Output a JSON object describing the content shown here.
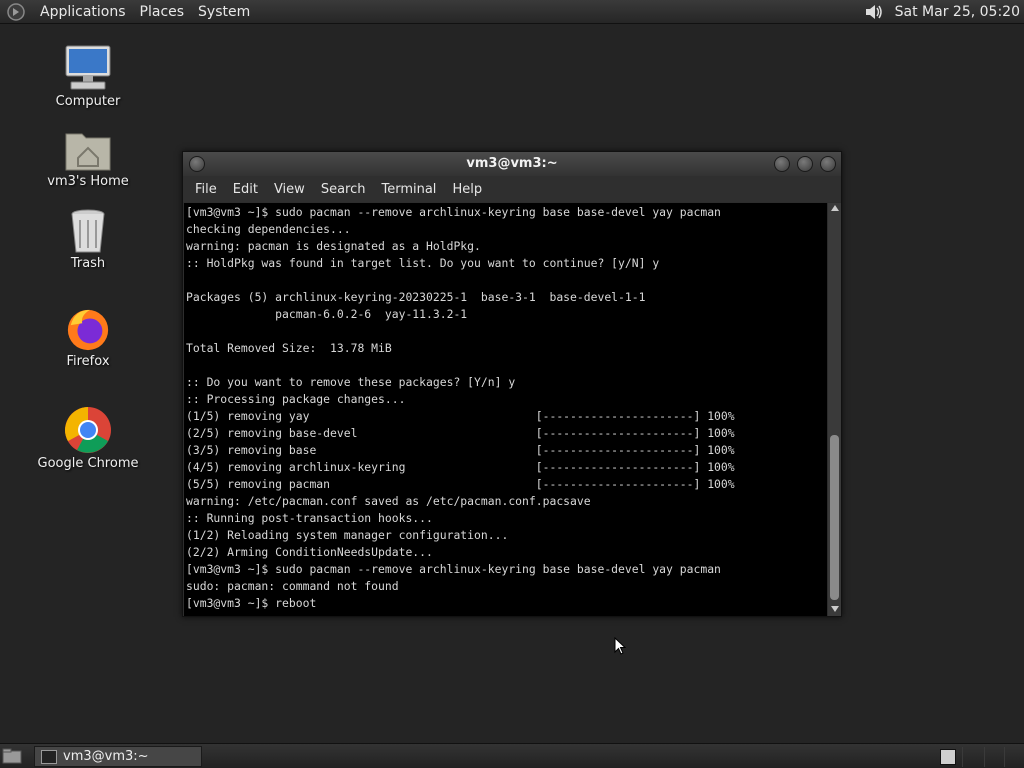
{
  "top_panel": {
    "menus": [
      "Applications",
      "Places",
      "System"
    ],
    "clock": "Sat Mar 25, 05:20"
  },
  "desktop_icons": [
    {
      "label": "Computer"
    },
    {
      "label": "vm3's Home"
    },
    {
      "label": "Trash"
    },
    {
      "label": "Firefox"
    },
    {
      "label": "Google Chrome"
    }
  ],
  "terminal": {
    "title": "vm3@vm3:~",
    "menu": [
      "File",
      "Edit",
      "View",
      "Search",
      "Terminal",
      "Help"
    ],
    "lines": [
      "[vm3@vm3 ~]$ sudo pacman --remove archlinux-keyring base base-devel yay pacman",
      "checking dependencies...",
      "warning: pacman is designated as a HoldPkg.",
      ":: HoldPkg was found in target list. Do you want to continue? [y/N] y",
      "",
      "Packages (5) archlinux-keyring-20230225-1  base-3-1  base-devel-1-1",
      "             pacman-6.0.2-6  yay-11.3.2-1",
      "",
      "Total Removed Size:  13.78 MiB",
      "",
      ":: Do you want to remove these packages? [Y/n] y",
      ":: Processing package changes...",
      "(1/5) removing yay                                 [----------------------] 100%",
      "(2/5) removing base-devel                          [----------------------] 100%",
      "(3/5) removing base                                [----------------------] 100%",
      "(4/5) removing archlinux-keyring                   [----------------------] 100%",
      "(5/5) removing pacman                              [----------------------] 100%",
      "warning: /etc/pacman.conf saved as /etc/pacman.conf.pacsave",
      ":: Running post-transaction hooks...",
      "(1/2) Reloading system manager configuration...",
      "(2/2) Arming ConditionNeedsUpdate...",
      "[vm3@vm3 ~]$ sudo pacman --remove archlinux-keyring base base-devel yay pacman",
      "sudo: pacman: command not found",
      "[vm3@vm3 ~]$ reboot"
    ]
  },
  "taskbar": {
    "window_button": "vm3@vm3:~"
  },
  "colors": {
    "desktop_bg": "#242424",
    "terminal_bg": "#000000",
    "terminal_fg": "#d8d8d8"
  }
}
